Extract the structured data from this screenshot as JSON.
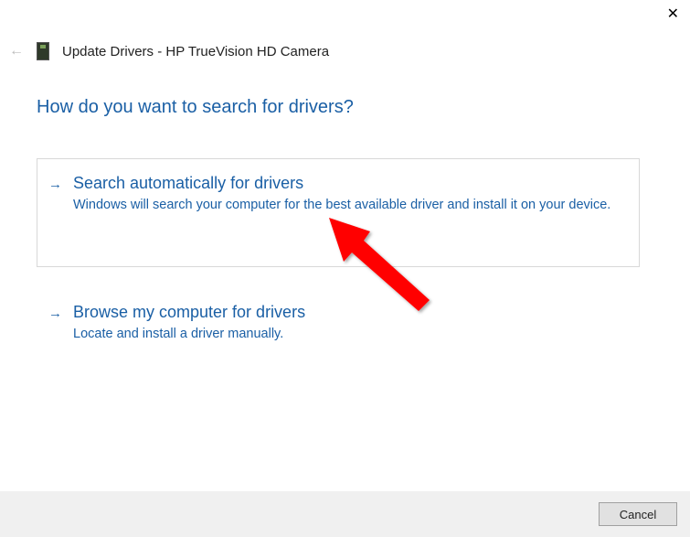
{
  "window": {
    "title": "Update Drivers - HP TrueVision HD Camera"
  },
  "heading": "How do you want to search for drivers?",
  "options": [
    {
      "title": "Search automatically for drivers",
      "desc": "Windows will search your computer for the best available driver and install it on your device."
    },
    {
      "title": "Browse my computer for drivers",
      "desc": "Locate and install a driver manually."
    }
  ],
  "buttons": {
    "cancel": "Cancel"
  }
}
